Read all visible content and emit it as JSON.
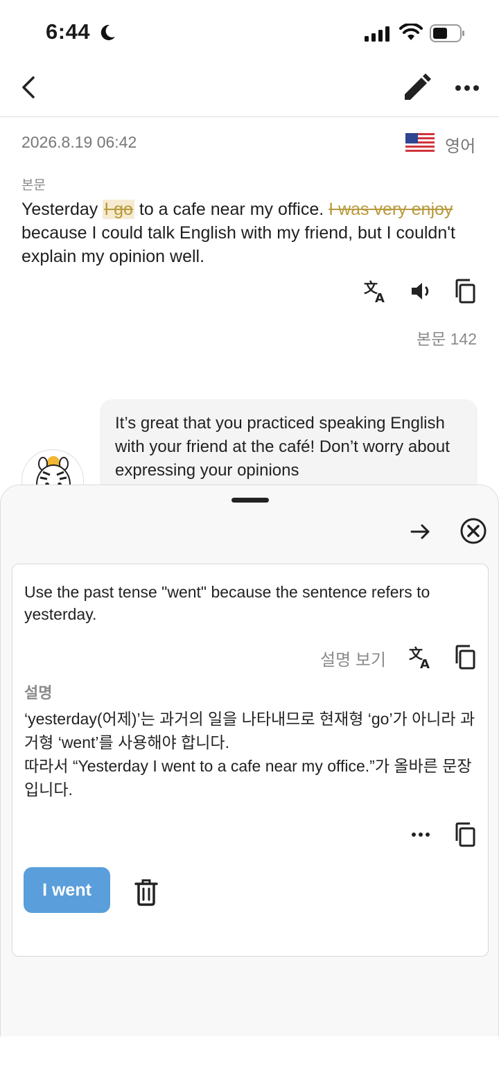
{
  "status_bar": {
    "time": "6:44"
  },
  "entry": {
    "date": "2026.8.19 06:42",
    "language": "영어",
    "body_label": "본문",
    "text": {
      "part1": "Yesterday ",
      "strike1": "I go",
      "part2": " to a cafe near my office. ",
      "strike2": "I was very enjoy",
      "part3": " because I could talk English with my friend, but I couldn't explain my opinion well."
    },
    "char_count": "본문 142"
  },
  "chat": {
    "message": "It’s great that you practiced speaking English with your friend at the café! Don’t worry about expressing your opinions"
  },
  "correction": {
    "suggestion": "Use the past tense \"went\" because the sentence refers to yesterday.",
    "show_explanation": "설명 보기",
    "explanation_label": "설명",
    "explanation_line1": "‘yesterday(어제)’는 과거의 일을 나타내므로 현재형 ‘go’가 아니라 과거형 ‘went’를 사용해야 합니다.",
    "explanation_line2": "따라서 “Yesterday I went to a cafe near my office.”가 올바른 문장입니다.",
    "apply_label": "I went"
  },
  "colors": {
    "accent": "#5a9edb",
    "strike": "#b89a3c",
    "highlight": "#f6ead0"
  },
  "icons": [
    "back-icon",
    "edit-icon",
    "more-icon",
    "us-flag-icon",
    "translate-icon",
    "speaker-icon",
    "copy-icon",
    "arrow-right-icon",
    "close-icon",
    "trash-icon"
  ]
}
